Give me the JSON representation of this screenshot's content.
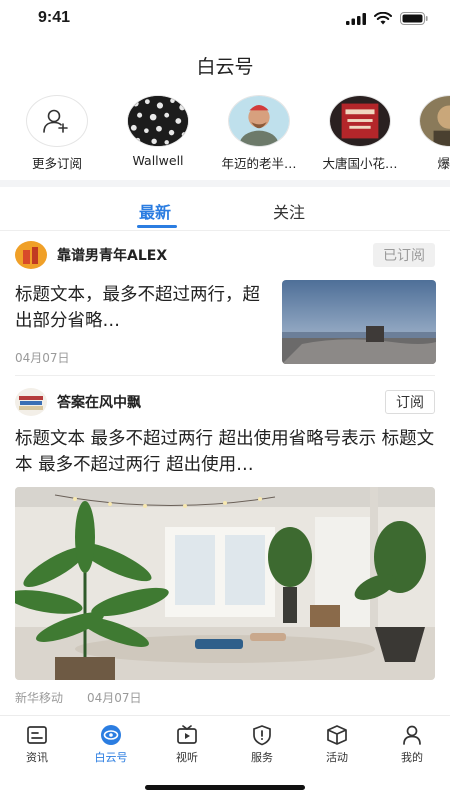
{
  "status": {
    "time": "9:41"
  },
  "nav": {
    "title": "白云号"
  },
  "subscriptions": [
    {
      "label": "更多订阅",
      "icon": "add-user-icon"
    },
    {
      "label": "Wallwell"
    },
    {
      "label": "年迈的老半…"
    },
    {
      "label": "大唐国小花…"
    },
    {
      "label": "爆炸"
    }
  ],
  "tabs": {
    "latest": "最新",
    "follow": "关注"
  },
  "feed": [
    {
      "author": "靠谱男青年ALEX",
      "subscribe_label": "已订阅",
      "title": "标题文本，最多不超过两行，超出部分省略…",
      "date": "04月07日"
    },
    {
      "author": "答案在风中飘",
      "subscribe_label": "订阅",
      "title": "标题文本 最多不超过两行 超出使用省略号表示 标题文本 最多不超过两行 超出使用…",
      "source": "新华移动",
      "date": "04月07日"
    }
  ],
  "bottom_nav": [
    {
      "label": "资讯",
      "icon": "news-icon"
    },
    {
      "label": "白云号",
      "icon": "eye-icon"
    },
    {
      "label": "视听",
      "icon": "tv-icon"
    },
    {
      "label": "服务",
      "icon": "shield-icon"
    },
    {
      "label": "活动",
      "icon": "box-icon"
    },
    {
      "label": "我的",
      "icon": "person-icon"
    }
  ],
  "colors": {
    "accent": "#2b7de1",
    "muted": "#9a9a9a",
    "divider": "#f3f4f6"
  }
}
